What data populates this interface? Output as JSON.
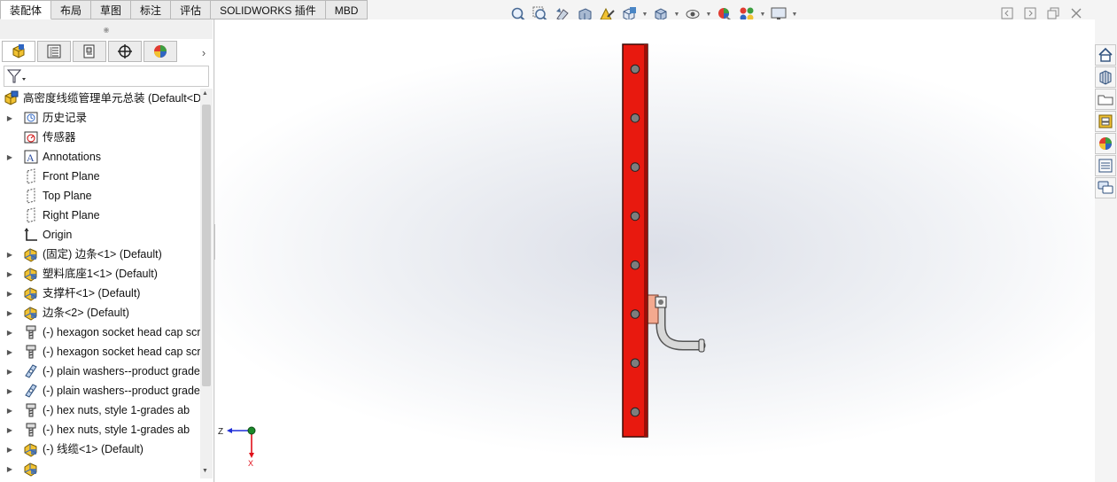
{
  "tabs": [
    {
      "label": "装配体",
      "active": true
    },
    {
      "label": "布局",
      "active": false
    },
    {
      "label": "草图",
      "active": false
    },
    {
      "label": "标注",
      "active": false
    },
    {
      "label": "评估",
      "active": false
    },
    {
      "label": "SOLIDWORKS 插件",
      "active": false
    },
    {
      "label": "MBD",
      "active": false
    }
  ],
  "view_toolbar_icons": [
    "zoom-to-fit-icon",
    "zoom-to-area-icon",
    "previous-view-icon",
    "section-view-icon",
    "dynamic-annotation-icon",
    "view-orientation-icon",
    "display-style-icon",
    "hide-show-items-icon",
    "edit-appearance-icon",
    "apply-scene-icon",
    "view-settings-icon"
  ],
  "panel_tabs": [
    "feature-manager-icon",
    "property-manager-icon",
    "configuration-manager-icon",
    "dimxpert-manager-icon",
    "display-manager-icon"
  ],
  "tree": [
    {
      "label": "高密度线缆管理单元总装  (Default<Def",
      "icon": "assembly-icon",
      "level": 0,
      "expandable": false
    },
    {
      "label": "历史记录",
      "icon": "history-icon",
      "level": 1,
      "expandable": true
    },
    {
      "label": "传感器",
      "icon": "sensor-icon",
      "level": 1,
      "expandable": false
    },
    {
      "label": "Annotations",
      "icon": "annotations-icon",
      "level": 1,
      "expandable": true
    },
    {
      "label": "Front Plane",
      "icon": "plane-icon",
      "level": 1,
      "expandable": false
    },
    {
      "label": "Top Plane",
      "icon": "plane-icon",
      "level": 1,
      "expandable": false
    },
    {
      "label": "Right Plane",
      "icon": "plane-icon",
      "level": 1,
      "expandable": false
    },
    {
      "label": "Origin",
      "icon": "origin-icon",
      "level": 1,
      "expandable": false
    },
    {
      "label": "(固定) 边条<1> (Default)",
      "icon": "part-icon",
      "level": 1,
      "expandable": true
    },
    {
      "label": "塑料底座1<1> (Default)",
      "icon": "part-icon",
      "level": 1,
      "expandable": true
    },
    {
      "label": "支撑杆<1> (Default)",
      "icon": "part-icon",
      "level": 1,
      "expandable": true
    },
    {
      "label": "边条<2> (Default)",
      "icon": "part-icon",
      "level": 1,
      "expandable": true
    },
    {
      "label": "(-) hexagon socket head cap scr",
      "icon": "screw-icon",
      "level": 1,
      "expandable": true
    },
    {
      "label": "(-) hexagon socket head cap scr",
      "icon": "screw-icon",
      "level": 1,
      "expandable": true
    },
    {
      "label": "(-) plain washers--product grade",
      "icon": "washer-icon",
      "level": 1,
      "expandable": true
    },
    {
      "label": "(-) plain washers--product grade",
      "icon": "washer-icon",
      "level": 1,
      "expandable": true
    },
    {
      "label": "(-) hex nuts, style 1-grades ab",
      "icon": "screw-icon",
      "level": 1,
      "expandable": true
    },
    {
      "label": "(-) hex nuts, style 1-grades ab",
      "icon": "screw-icon",
      "level": 1,
      "expandable": true
    },
    {
      "label": "(-) 线缆<1> (Default)",
      "icon": "part-icon",
      "level": 1,
      "expandable": true
    },
    {
      "label": "",
      "icon": "part-icon",
      "level": 1,
      "expandable": true
    }
  ],
  "triad": {
    "z": "Z",
    "x": "X"
  },
  "task_pane_icons": [
    "home-icon",
    "design-library-icon",
    "file-explorer-icon",
    "view-palette-icon",
    "appearances-icon",
    "custom-properties-icon",
    "forum-icon"
  ],
  "colors": {
    "rail": "#e8190f",
    "bracket": "#f4a98f",
    "cable": "#d8d8d8"
  }
}
